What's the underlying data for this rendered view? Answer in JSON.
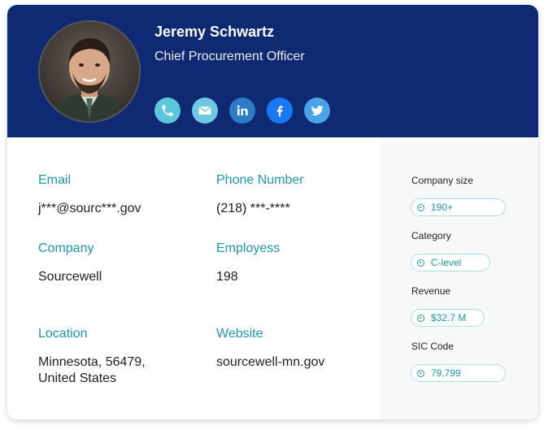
{
  "profile": {
    "name": "Jeremy Schwartz",
    "title": "Chief Procurement Officer"
  },
  "socials": [
    {
      "icon": "phone-icon",
      "color": "#5bc6dc"
    },
    {
      "icon": "email-icon",
      "color": "#6cc9e3"
    },
    {
      "icon": "linkedin-icon",
      "color": "#2d7cc6"
    },
    {
      "icon": "facebook-icon",
      "color": "#1877f2"
    },
    {
      "icon": "twitter-icon",
      "color": "#4aa3e6"
    }
  ],
  "details": {
    "email_label": "Email",
    "email_value": "j***@sourc***.gov",
    "phone_label": "Phone Number",
    "phone_value": "(218) ***-****",
    "company_label": "Company",
    "company_value": "Sourcewell",
    "employees_label": "Employess",
    "employees_value": "198",
    "location_label": "Location",
    "location_line1": "Minnesota, 56479,",
    "location_line2": "United States",
    "website_label": "Website",
    "website_value": "sourcewell-mn.gov"
  },
  "sidebar": {
    "company_size_label": "Company size",
    "company_size_value": "190+",
    "category_label": "Category",
    "category_value": "C-level",
    "revenue_label": "Revenue",
    "revenue_value": "$32.7 M",
    "sic_label": "SIC Code",
    "sic_value": "79,799"
  },
  "colors": {
    "header_bg": "#0f2a72",
    "accent": "#1e9ab0"
  }
}
